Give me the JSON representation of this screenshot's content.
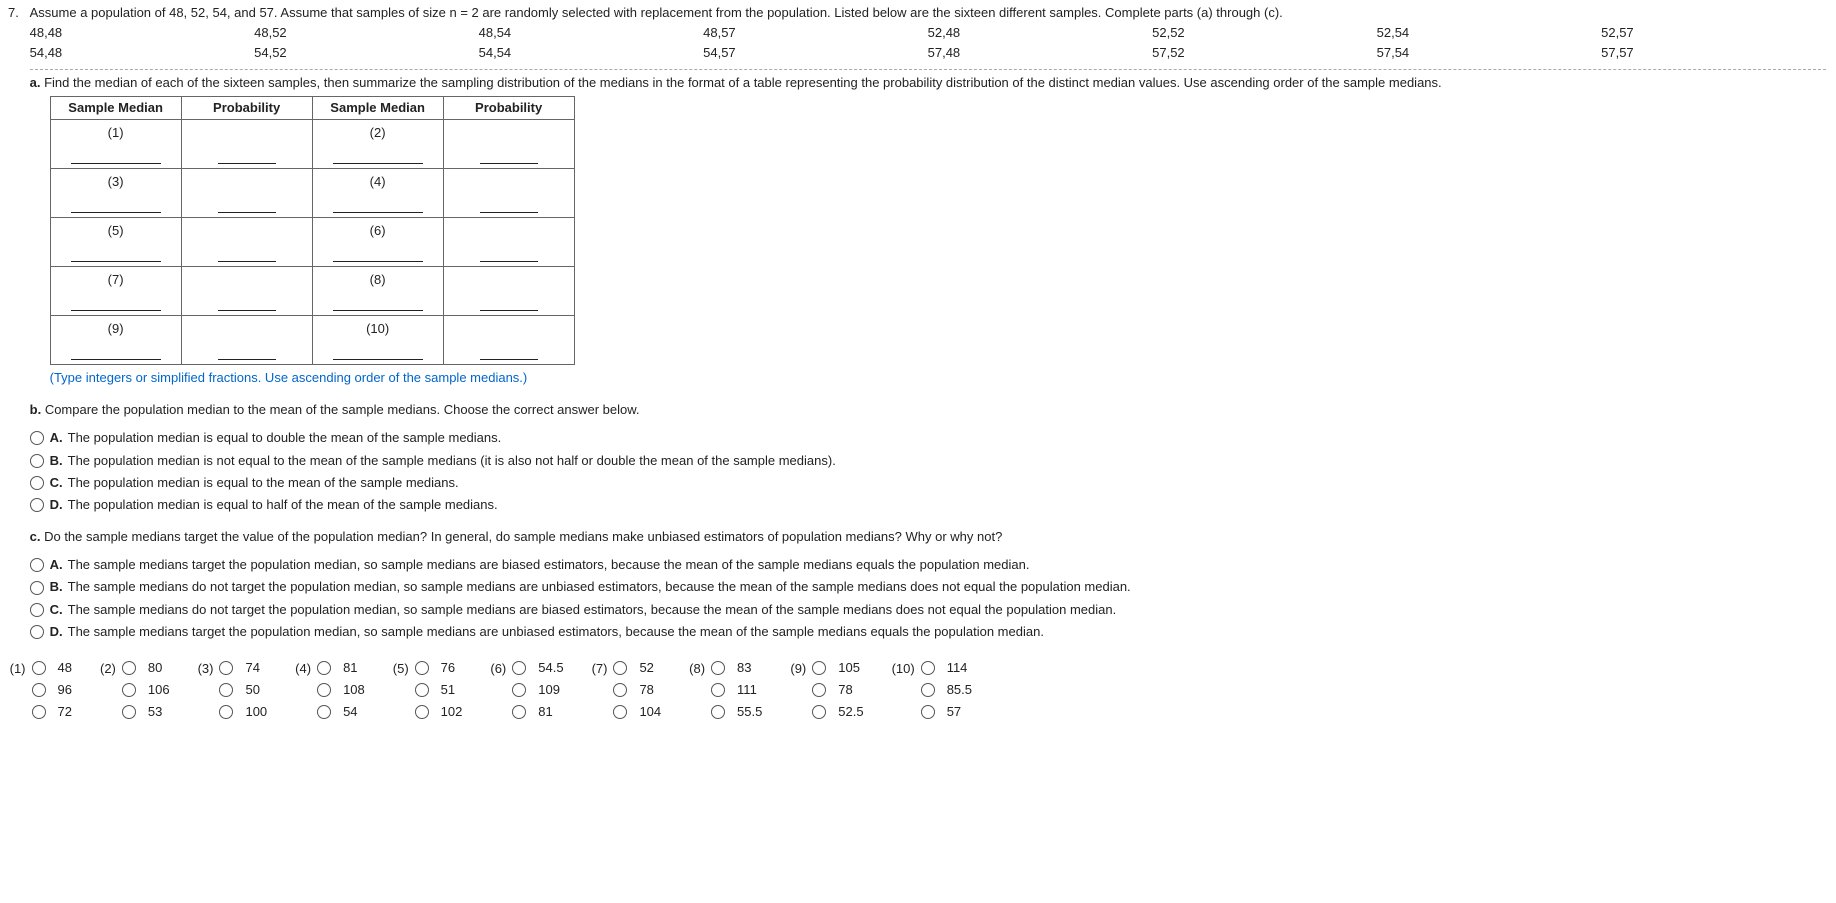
{
  "qnum": "7.",
  "prompt": "Assume a population of 48, 52, 54, and 57. Assume that samples of size n = 2 are randomly selected with replacement from the population. Listed below are the sixteen different samples. Complete parts (a) through (c).",
  "samples_row1": [
    "48,48",
    "48,52",
    "48,54",
    "48,57",
    "52,48",
    "52,52",
    "52,54",
    "52,57"
  ],
  "samples_row2": [
    "54,48",
    "54,52",
    "54,54",
    "54,57",
    "57,48",
    "57,52",
    "57,54",
    "57,57"
  ],
  "a_label": "a.",
  "a_text": "Find the median of each of the sixteen samples, then summarize the sampling distribution of the medians in the format of a table representing the probability distribution of the distinct median values. Use ascending order of the sample medians.",
  "table_headers": [
    "Sample Median",
    "Probability",
    "Sample Median",
    "Probability"
  ],
  "table_cells": [
    [
      "(1)",
      "",
      "(2)",
      ""
    ],
    [
      "(3)",
      "",
      "(4)",
      ""
    ],
    [
      "(5)",
      "",
      "(6)",
      ""
    ],
    [
      "(7)",
      "",
      "(8)",
      ""
    ],
    [
      "(9)",
      "",
      "(10)",
      ""
    ]
  ],
  "a_hint": "(Type integers or simplified fractions. Use ascending order of the sample medians.)",
  "b_label": "b.",
  "b_text": "Compare the population median to the mean of the sample medians. Choose the correct answer below.",
  "b_choices": {
    "A": "The population median is equal to double the mean of the sample medians.",
    "B": "The population median is not equal to the mean of the sample medians (it is also not half or double the mean of the sample medians).",
    "C": "The population median is equal to the mean of the sample medians.",
    "D": "The population median is equal to half of the mean of the sample medians."
  },
  "c_label": "c.",
  "c_text": "Do the sample medians target the value of the population median? In general, do sample medians make unbiased estimators of population medians? Why or why not?",
  "c_choices": {
    "A": "The sample medians target the population median, so sample medians are biased estimators, because the mean of the sample medians equals the population median.",
    "B": "The sample medians do not target the population median, so sample medians are unbiased estimators, because the mean of the sample medians does not equal the population median.",
    "C": "The sample medians do not target the population median, so sample medians are biased estimators, because the mean of the sample medians does not equal the population median.",
    "D": "The sample medians target the population median, so sample medians are unbiased estimators, because the mean of the sample medians equals the population median."
  },
  "ans_groups": [
    {
      "label": "(1)",
      "opts": [
        "48",
        "96",
        "72"
      ]
    },
    {
      "label": "(2)",
      "opts": [
        "80",
        "106",
        "53"
      ]
    },
    {
      "label": "(3)",
      "opts": [
        "74",
        "50",
        "100"
      ]
    },
    {
      "label": "(4)",
      "opts": [
        "81",
        "108",
        "54"
      ]
    },
    {
      "label": "(5)",
      "opts": [
        "76",
        "51",
        "102"
      ]
    },
    {
      "label": "(6)",
      "opts": [
        "54.5",
        "109",
        "81"
      ]
    },
    {
      "label": "(7)",
      "opts": [
        "52",
        "78",
        "104"
      ]
    },
    {
      "label": "(8)",
      "opts": [
        "83",
        "111",
        "55.5"
      ]
    },
    {
      "label": "(9)",
      "opts": [
        "105",
        "78",
        "52.5"
      ]
    },
    {
      "label": "(10)",
      "opts": [
        "114",
        "85.5",
        "57"
      ]
    }
  ]
}
